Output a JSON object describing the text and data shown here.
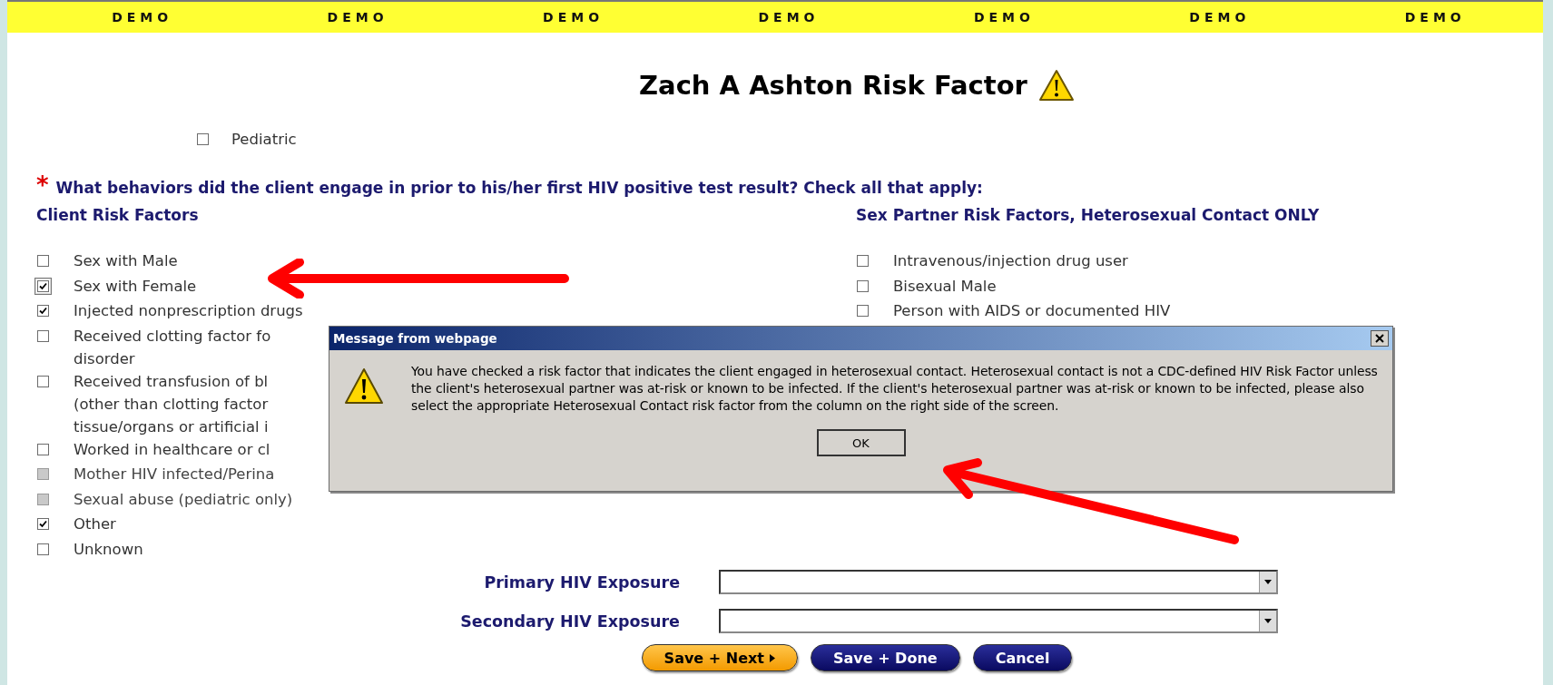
{
  "demo_banner": [
    "DEMO",
    "DEMO",
    "DEMO",
    "DEMO",
    "DEMO",
    "DEMO",
    "DEMO"
  ],
  "title": "Zach A Ashton Risk Factor",
  "pediatric": {
    "label": "Pediatric",
    "checked": false
  },
  "question": {
    "required_mark": "*",
    "text": "What behaviors did the client engage in prior to his/her first HIV positive test result? Check all that apply:"
  },
  "client_risk_factors": {
    "heading": "Client Risk Factors",
    "items": [
      {
        "lines": [
          "Sex with Male"
        ],
        "checked": false,
        "disabled": false,
        "focused": false
      },
      {
        "lines": [
          "Sex with Female"
        ],
        "checked": true,
        "disabled": false,
        "focused": true
      },
      {
        "lines": [
          "Injected nonprescription drugs"
        ],
        "checked": true,
        "disabled": false,
        "focused": false
      },
      {
        "lines": [
          "Received clotting factor fo",
          "disorder"
        ],
        "checked": false,
        "disabled": false,
        "focused": false
      },
      {
        "lines": [
          "Received transfusion of bl",
          "(other than clotting factor",
          "tissue/organs or artificial i"
        ],
        "checked": false,
        "disabled": false,
        "focused": false
      },
      {
        "lines": [
          "Worked in healthcare or cl"
        ],
        "checked": false,
        "disabled": false,
        "focused": false
      },
      {
        "lines": [
          "Mother HIV infected/Perina"
        ],
        "checked": false,
        "disabled": true,
        "focused": false
      },
      {
        "lines": [
          "Sexual abuse (pediatric only)"
        ],
        "checked": false,
        "disabled": true,
        "focused": false
      },
      {
        "lines": [
          "Other"
        ],
        "checked": true,
        "disabled": false,
        "focused": false
      },
      {
        "lines": [
          "Unknown"
        ],
        "checked": false,
        "disabled": false,
        "focused": false
      }
    ]
  },
  "partner_risk_factors": {
    "heading": "Sex Partner Risk Factors, Heterosexual Contact ONLY",
    "items": [
      {
        "lines": [
          "Intravenous/injection drug user"
        ],
        "checked": false,
        "disabled": false,
        "focused": false
      },
      {
        "lines": [
          "Bisexual Male"
        ],
        "checked": false,
        "disabled": false,
        "focused": false
      },
      {
        "lines": [
          "Person with AIDS or documented HIV"
        ],
        "checked": false,
        "disabled": false,
        "focused": false
      }
    ]
  },
  "exposures": [
    {
      "label": "Primary HIV Exposure"
    },
    {
      "label": "Secondary HIV Exposure"
    }
  ],
  "buttons": [
    {
      "label": "Save + Next",
      "kind": "next"
    },
    {
      "label": "Save + Done",
      "kind": "plain"
    },
    {
      "label": "Cancel",
      "kind": "plain"
    }
  ],
  "dialog": {
    "title": "Message from webpage",
    "message": "You have checked a risk factor that indicates the client engaged in heterosexual contact. Heterosexual contact is not a CDC-defined HIV Risk Factor unless the client's heterosexual partner was at-risk or known to be infected. If the client's heterosexual partner was at-risk or known to be infected, please also select the appropriate Heterosexual Contact risk factor from the column on the right side of the screen.",
    "button": "OK"
  }
}
